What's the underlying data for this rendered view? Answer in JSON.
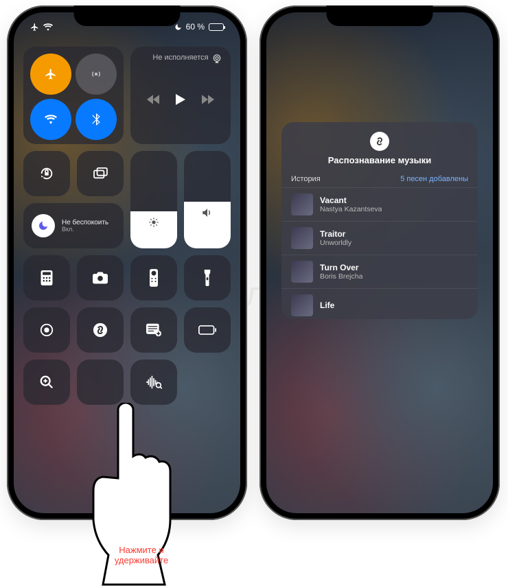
{
  "status": {
    "battery_label": "60 %"
  },
  "left": {
    "media_title": "Не исполняется",
    "dnd": {
      "title": "Не беспокоить",
      "subtitle": "Вкл."
    }
  },
  "right": {
    "shazam": {
      "title": "Распознавание музыки",
      "history_label": "История",
      "count_label": "5 песен добавлены",
      "songs": [
        {
          "title": "Vacant",
          "artist": "Nastya Kazantseva"
        },
        {
          "title": "Traitor",
          "artist": "Unworldly"
        },
        {
          "title": "Turn Over",
          "artist": "Boris Brejcha"
        },
        {
          "title": "Life",
          "artist": ""
        }
      ]
    }
  },
  "overlay": {
    "hand_caption": "Нажмите и удерживайте"
  },
  "watermark": "Яблык"
}
